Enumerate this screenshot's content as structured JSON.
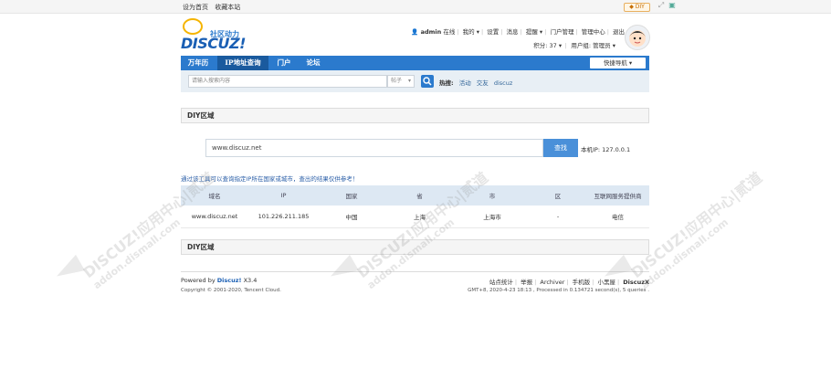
{
  "topbar": {
    "set_home": "设为首页",
    "bookmark": "收藏本站",
    "diy_label": "DIY"
  },
  "logo": {
    "slogan": "社区动力",
    "word": "DISCUZ!"
  },
  "user": {
    "name": "admin",
    "status": "在线",
    "mine": "我的",
    "settings": "设置",
    "messages": "消息",
    "reminders": "提醒",
    "portal_manage": "门户管理",
    "admin_center": "管理中心",
    "logout": "退出",
    "points": "积分: 37",
    "usergroup": "用户组: 管理员"
  },
  "nav": {
    "items": [
      {
        "label": "万年历"
      },
      {
        "label": "IP地址查询"
      },
      {
        "label": "门户"
      },
      {
        "label": "论坛"
      }
    ],
    "quick": "快捷导航"
  },
  "search": {
    "placeholder": "请输入搜索内容",
    "type": "帖子",
    "hot_label": "热搜:",
    "hot_items": [
      "活动",
      "交友",
      "discuz"
    ]
  },
  "diy": {
    "area_label": "DIY区域"
  },
  "query": {
    "domain_value": "www.discuz.net",
    "button": "查找",
    "local_ip": "本机IP: 127.0.0.1",
    "tip": "通过该工具可以查询指定IP所在国家或城市，查出的结果仅供参考！"
  },
  "table": {
    "headers": [
      "域名",
      "IP",
      "国家",
      "省",
      "市",
      "区",
      "互联网服务提供商"
    ],
    "rows": [
      [
        "www.discuz.net",
        "101.226.211.185",
        "中国",
        "上海",
        "上海市",
        "-",
        "电信"
      ]
    ]
  },
  "footer": {
    "powered": "Powered by",
    "brand": "Discuz!",
    "version": "X3.4",
    "copyright": "Copyright © 2001-2020, Tencent Cloud.",
    "links": [
      "站点统计",
      "举报",
      "Archiver",
      "手机版",
      "小黑屋"
    ],
    "brand_right": "DiscuzX",
    "stats": "GMT+8, 2020-4-23 18:13 , Processed in 0.134721 second(s), 5 queries ."
  },
  "watermark": {
    "text1": "DISCUZ!应用中心|贰道",
    "text2": "addon.dismall.com"
  },
  "colors": {
    "nav": "#2b7acd",
    "nav_active": "#1a5a9e",
    "query_button": "#4a90d9",
    "table_header": "#dde8f3"
  }
}
